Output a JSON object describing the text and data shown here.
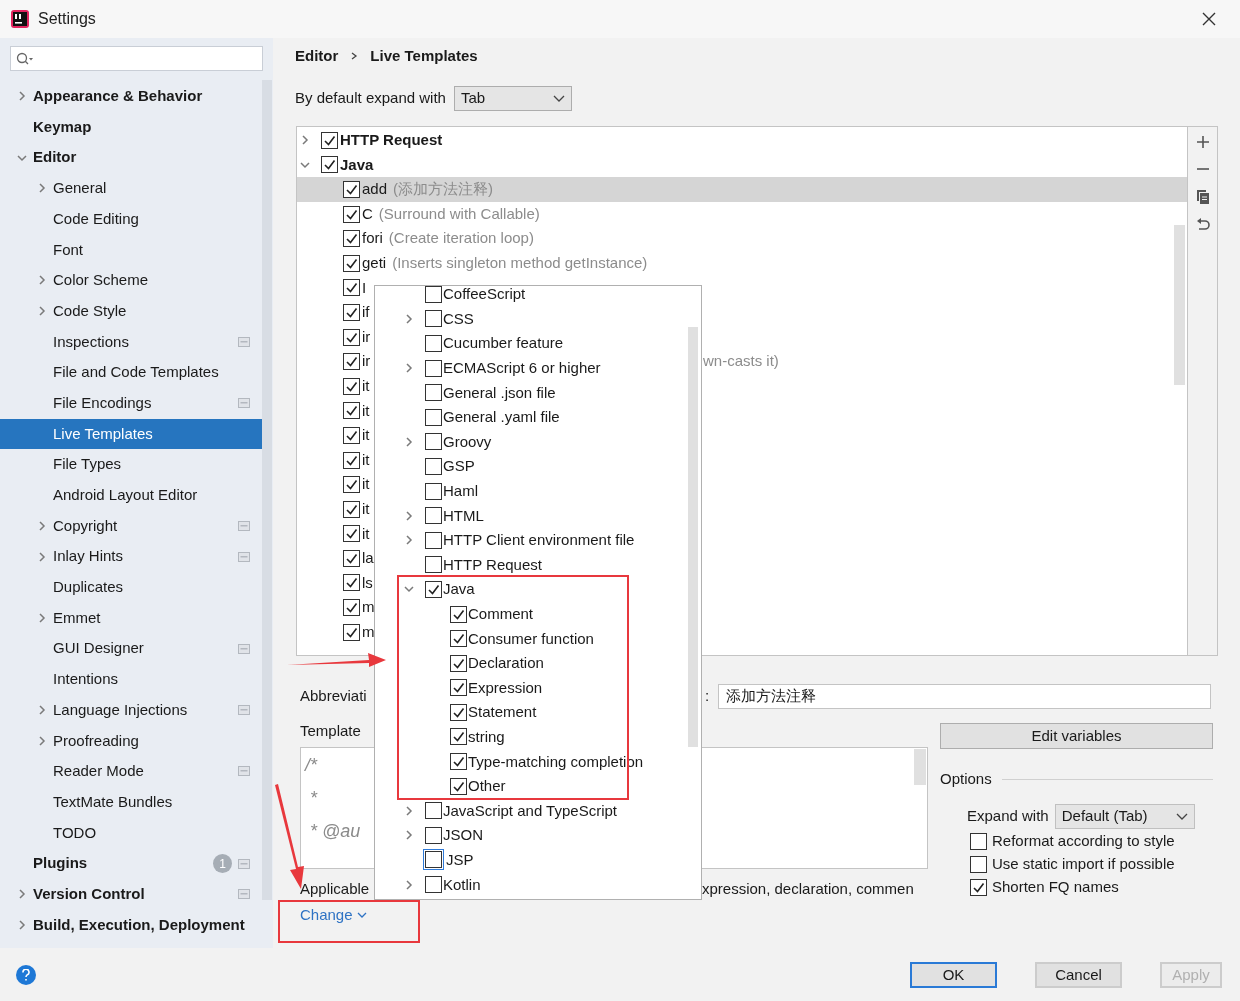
{
  "window": {
    "title": "Settings"
  },
  "sidebar": {
    "items": [
      {
        "label": "Appearance & Behavior",
        "selected": false,
        "expanded": false
      },
      {
        "label": "Keymap",
        "selected": false
      },
      {
        "label": "Editor",
        "selected": false,
        "expanded": true,
        "children": [
          {
            "label": "General",
            "selected": false,
            "expanded": false
          },
          {
            "label": "Code Editing",
            "selected": false
          },
          {
            "label": "Font",
            "selected": false
          },
          {
            "label": "Color Scheme",
            "selected": false,
            "expanded": false
          },
          {
            "label": "Code Style",
            "selected": false,
            "expanded": false
          },
          {
            "label": "Inspections",
            "selected": false,
            "project_icon": true
          },
          {
            "label": "File and Code Templates",
            "selected": false
          },
          {
            "label": "File Encodings",
            "selected": false,
            "project_icon": true
          },
          {
            "label": "Live Templates",
            "selected": true
          },
          {
            "label": "File Types",
            "selected": false
          },
          {
            "label": "Android Layout Editor",
            "selected": false
          },
          {
            "label": "Copyright",
            "selected": false,
            "expanded": false,
            "project_icon": true
          },
          {
            "label": "Inlay Hints",
            "selected": false,
            "expanded": false,
            "project_icon": true
          },
          {
            "label": "Duplicates",
            "selected": false
          },
          {
            "label": "Emmet",
            "selected": false,
            "expanded": false
          },
          {
            "label": "GUI Designer",
            "selected": false,
            "project_icon": true
          },
          {
            "label": "Intentions",
            "selected": false
          },
          {
            "label": "Language Injections",
            "selected": false,
            "expanded": false,
            "project_icon": true
          },
          {
            "label": "Proofreading",
            "selected": false,
            "expanded": false
          },
          {
            "label": "Reader Mode",
            "selected": false,
            "project_icon": true
          },
          {
            "label": "TextMate Bundles",
            "selected": false
          },
          {
            "label": "TODO",
            "selected": false
          }
        ]
      },
      {
        "label": "Plugins",
        "selected": false,
        "badge": "1",
        "project_icon": true
      },
      {
        "label": "Version Control",
        "selected": false,
        "expanded": false,
        "project_icon": true
      },
      {
        "label": "Build, Execution, Deployment",
        "selected": false,
        "expanded": false
      }
    ]
  },
  "breadcrumb": [
    "Editor",
    "Live Templates"
  ],
  "expand_default": {
    "label": "By default expand with",
    "value": "Tab"
  },
  "template_groups": [
    {
      "label": "HTTP Request",
      "checked": true,
      "expanded": false
    },
    {
      "label": "Java",
      "checked": true,
      "expanded": true,
      "children": [
        {
          "abbreviation": "add",
          "description": "(添加方法注释)",
          "checked": true,
          "selected": true
        },
        {
          "abbreviation": "C",
          "description": "(Surround with Callable)",
          "checked": true,
          "selected": false
        },
        {
          "abbreviation": "fori",
          "description": "(Create iteration loop)",
          "checked": true,
          "selected": false
        },
        {
          "abbreviation": "geti",
          "description": "(Inserts singleton method getInstance)",
          "checked": true,
          "selected": false
        },
        {
          "abbreviation": "I",
          "checked": true,
          "selected": false
        },
        {
          "abbreviation": "if",
          "checked": true,
          "selected": false
        },
        {
          "abbreviation": "ir",
          "checked": true,
          "selected": false
        },
        {
          "abbreviation": "ir",
          "tail": "wn-casts it)",
          "checked": true,
          "selected": false
        },
        {
          "abbreviation": "it",
          "checked": true,
          "selected": false
        },
        {
          "abbreviation": "it",
          "checked": true,
          "selected": false
        },
        {
          "abbreviation": "it",
          "checked": true,
          "selected": false
        },
        {
          "abbreviation": "it",
          "checked": true,
          "selected": false
        },
        {
          "abbreviation": "it",
          "checked": true,
          "selected": false
        },
        {
          "abbreviation": "it",
          "checked": true,
          "selected": false
        },
        {
          "abbreviation": "it",
          "checked": true,
          "selected": false
        },
        {
          "abbreviation": "la",
          "checked": true,
          "selected": false
        },
        {
          "abbreviation": "ls",
          "checked": true,
          "selected": false
        },
        {
          "abbreviation": "m",
          "checked": true,
          "selected": false
        },
        {
          "abbreviation": "m",
          "checked": true,
          "selected": false
        }
      ]
    }
  ],
  "context_popup": {
    "items": [
      {
        "label": "CoffeeScript",
        "checked": false
      },
      {
        "label": "CSS",
        "checked": false,
        "expanded": false
      },
      {
        "label": "Cucumber feature",
        "checked": false
      },
      {
        "label": "ECMAScript 6 or higher",
        "checked": false,
        "expanded": false
      },
      {
        "label": "General .json file",
        "checked": false
      },
      {
        "label": "General .yaml file",
        "checked": false
      },
      {
        "label": "Groovy",
        "checked": false,
        "expanded": false
      },
      {
        "label": "GSP",
        "checked": false
      },
      {
        "label": "Haml",
        "checked": false
      },
      {
        "label": "HTML",
        "checked": false,
        "expanded": false
      },
      {
        "label": "HTTP Client environment file",
        "checked": false,
        "expanded": false
      },
      {
        "label": "HTTP Request",
        "checked": false
      },
      {
        "label": "Java",
        "checked": true,
        "expanded": true,
        "children": [
          {
            "label": "Comment",
            "checked": true
          },
          {
            "label": "Consumer function",
            "checked": true
          },
          {
            "label": "Declaration",
            "checked": true
          },
          {
            "label": "Expression",
            "checked": true
          },
          {
            "label": "Statement",
            "checked": true
          },
          {
            "label": "string",
            "checked": true
          },
          {
            "label": "Type-matching completion",
            "checked": true
          },
          {
            "label": "Other",
            "checked": true
          }
        ]
      },
      {
        "label": "JavaScript and TypeScript",
        "checked": false,
        "expanded": false
      },
      {
        "label": "JSON",
        "checked": false,
        "expanded": false
      },
      {
        "label": "JSP",
        "checked": false,
        "focused": true
      },
      {
        "label": "Kotlin",
        "checked": false,
        "expanded": false
      }
    ]
  },
  "abbreviation": {
    "label": "Abbreviati",
    "separator": ":",
    "value": "添加方法注释"
  },
  "template_text": {
    "label": "Template",
    "lines": [
      "/*",
      " *",
      " * @au"
    ]
  },
  "applicable": {
    "label": "Applicable",
    "text": "xpression, declaration, commen",
    "link": "Change"
  },
  "edit_variables": "Edit variables",
  "options": {
    "title": "Options",
    "expand_with": {
      "label": "Expand with",
      "value": "Default (Tab)"
    },
    "checkboxes": [
      {
        "label": "Reformat according to style",
        "checked": false
      },
      {
        "label": "Use static import if possible",
        "checked": false
      },
      {
        "label": "Shorten FQ names",
        "checked": true
      }
    ]
  },
  "buttons": [
    {
      "label": "OK",
      "primary": true,
      "disabled": false
    },
    {
      "label": "Cancel",
      "primary": false,
      "disabled": false
    },
    {
      "label": "Apply",
      "primary": false,
      "disabled": true
    }
  ]
}
